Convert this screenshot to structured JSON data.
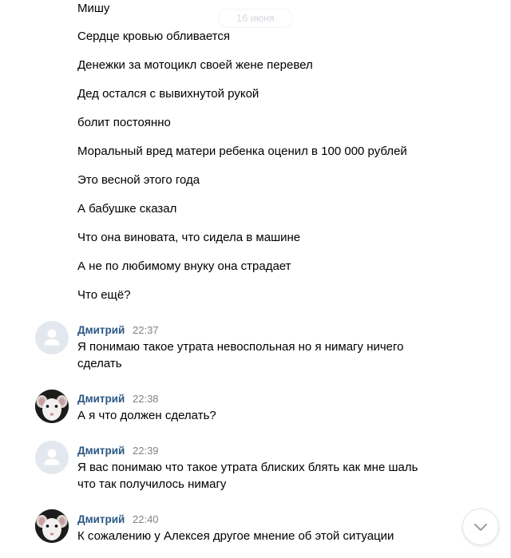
{
  "date_separator": "16 июня",
  "prior_lines": [
    "Мишу",
    "Сердце кровью обливается",
    "Денежки за мотоцикл своей жене перевел",
    "Дед остался с вывихнутой рукой",
    "болит постоянно",
    "Моральный вред матери ребенка оценил в 100 000 рублей",
    "Это весной этого года",
    "А бабушке сказал",
    "Что она виновата, что сидела в машине",
    "А не по любимому внуку она страдает",
    "Что ещё?"
  ],
  "messages": [
    {
      "author": "Дмитрий",
      "time": "22:37",
      "avatar": "default-avatar",
      "text": "Я понимаю такое утрата невоспольная но я нимагу ничего сделать"
    },
    {
      "author": "Дмитрий",
      "time": "22:38",
      "avatar": "rat-photo-avatar",
      "text": "А я что должен сделать?"
    },
    {
      "author": "Дмитрий",
      "time": "22:39",
      "avatar": "default-avatar",
      "text": "Я вас понимаю что такое утрата блиских блять как мне шаль что так получилось нимагу"
    },
    {
      "author": "Дмитрий",
      "time": "22:40",
      "avatar": "rat-photo-avatar",
      "text": "К сожалению у Алексея другое мнение об этой ситуации"
    }
  ],
  "scroll_button_icon": "chevron-down-icon",
  "colors": {
    "author": "#2a5885",
    "time": "#828282",
    "text": "#000000",
    "scroll_icon": "#99a2ad"
  }
}
